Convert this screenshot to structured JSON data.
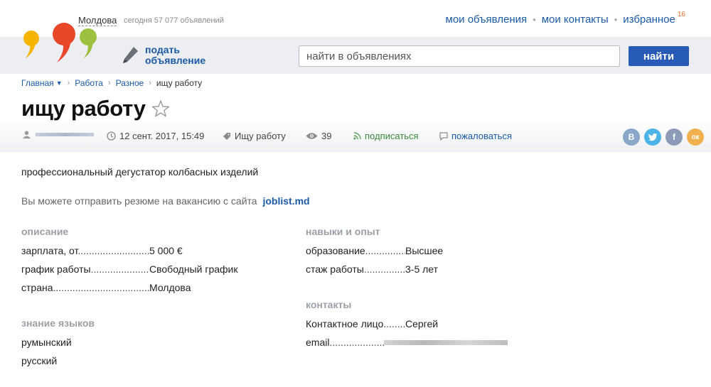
{
  "header": {
    "region": "Молдова",
    "today_text": "сегодня 57 077 объявлений",
    "nav": [
      "мои объявления",
      "мои контакты",
      "избранное"
    ],
    "favorites_count": "16",
    "post_ad_line1": "подать",
    "post_ad_line2": "объявление",
    "search_placeholder": "найти в объявлениях",
    "search_button": "найти"
  },
  "breadcrumbs": {
    "home": "Главная",
    "items": [
      "Работа",
      "Разное"
    ],
    "current": "ищу работу"
  },
  "ad": {
    "title": "ищу работу",
    "date": "12 сент. 2017, 15:49",
    "category": "Ищу работу",
    "views": "39",
    "subscribe": "подписаться",
    "complain": "пожаловаться",
    "social": [
      "В",
      "f",
      "ок"
    ],
    "description": "профессиональный дегустатор колбасных изделий",
    "resume_text": "Вы можете отправить резюме на вакансию с сайта",
    "resume_site": "joblist.md"
  },
  "sections": {
    "description": {
      "heading": "описание",
      "rows": [
        {
          "key": "зарплата, от",
          "value": "5 000 €"
        },
        {
          "key": "график работы",
          "value": "Свободный график"
        },
        {
          "key": "страна",
          "value": "Молдова"
        }
      ]
    },
    "languages": {
      "heading": "знание языков",
      "items": [
        "румынский",
        "русский"
      ]
    },
    "skills": {
      "heading": "навыки и опыт",
      "rows": [
        {
          "key": "образование",
          "value": "Высшее"
        },
        {
          "key": "стаж работы",
          "value": "3-5 лет"
        }
      ]
    },
    "contacts": {
      "heading": "контакты",
      "rows": [
        {
          "key": "Контактное лицо",
          "value": "Сергей"
        },
        {
          "key": "email",
          "value": ""
        }
      ]
    }
  },
  "colors": {
    "link": "#1a5aa6",
    "button": "#2759b7",
    "badge": "#e2702b",
    "green": "#3a8a3a"
  }
}
